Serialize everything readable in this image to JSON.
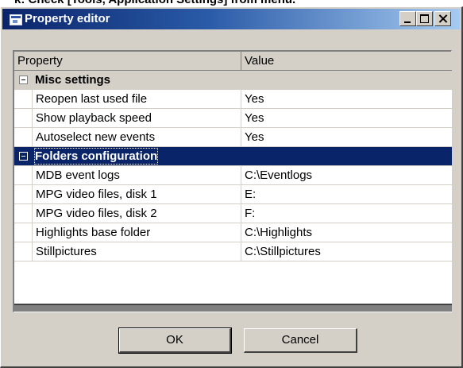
{
  "caption": "k: Check [Tools, Application Settings] from menu.",
  "window": {
    "title": "Property editor",
    "icon": "window-app-icon",
    "buttons": [
      "minimize",
      "maximize",
      "close"
    ]
  },
  "grid": {
    "headers": {
      "property": "Property",
      "value": "Value"
    },
    "categories": [
      {
        "label": "Misc settings",
        "expanded": true,
        "selected": false,
        "rows": [
          {
            "property": "Reopen last used file",
            "value": "Yes"
          },
          {
            "property": "Show playback speed",
            "value": "Yes"
          },
          {
            "property": "Autoselect new events",
            "value": "Yes"
          }
        ]
      },
      {
        "label": "Folders configuration",
        "expanded": true,
        "selected": true,
        "rows": [
          {
            "property": "MDB event logs",
            "value": "C:\\Eventlogs"
          },
          {
            "property": "MPG video files, disk 1",
            "value": "E:"
          },
          {
            "property": "MPG video files, disk 2",
            "value": "F:"
          },
          {
            "property": "Highlights base folder",
            "value": "C:\\Highlights"
          },
          {
            "property": "Stillpictures",
            "value": "C:\\Stillpictures"
          }
        ]
      }
    ]
  },
  "buttons": {
    "ok": "OK",
    "cancel": "Cancel"
  },
  "colors": {
    "titlebar_start": "#0a246a",
    "titlebar_end": "#a6caf0",
    "selection": "#0a246a",
    "face": "#d4d0c8"
  }
}
